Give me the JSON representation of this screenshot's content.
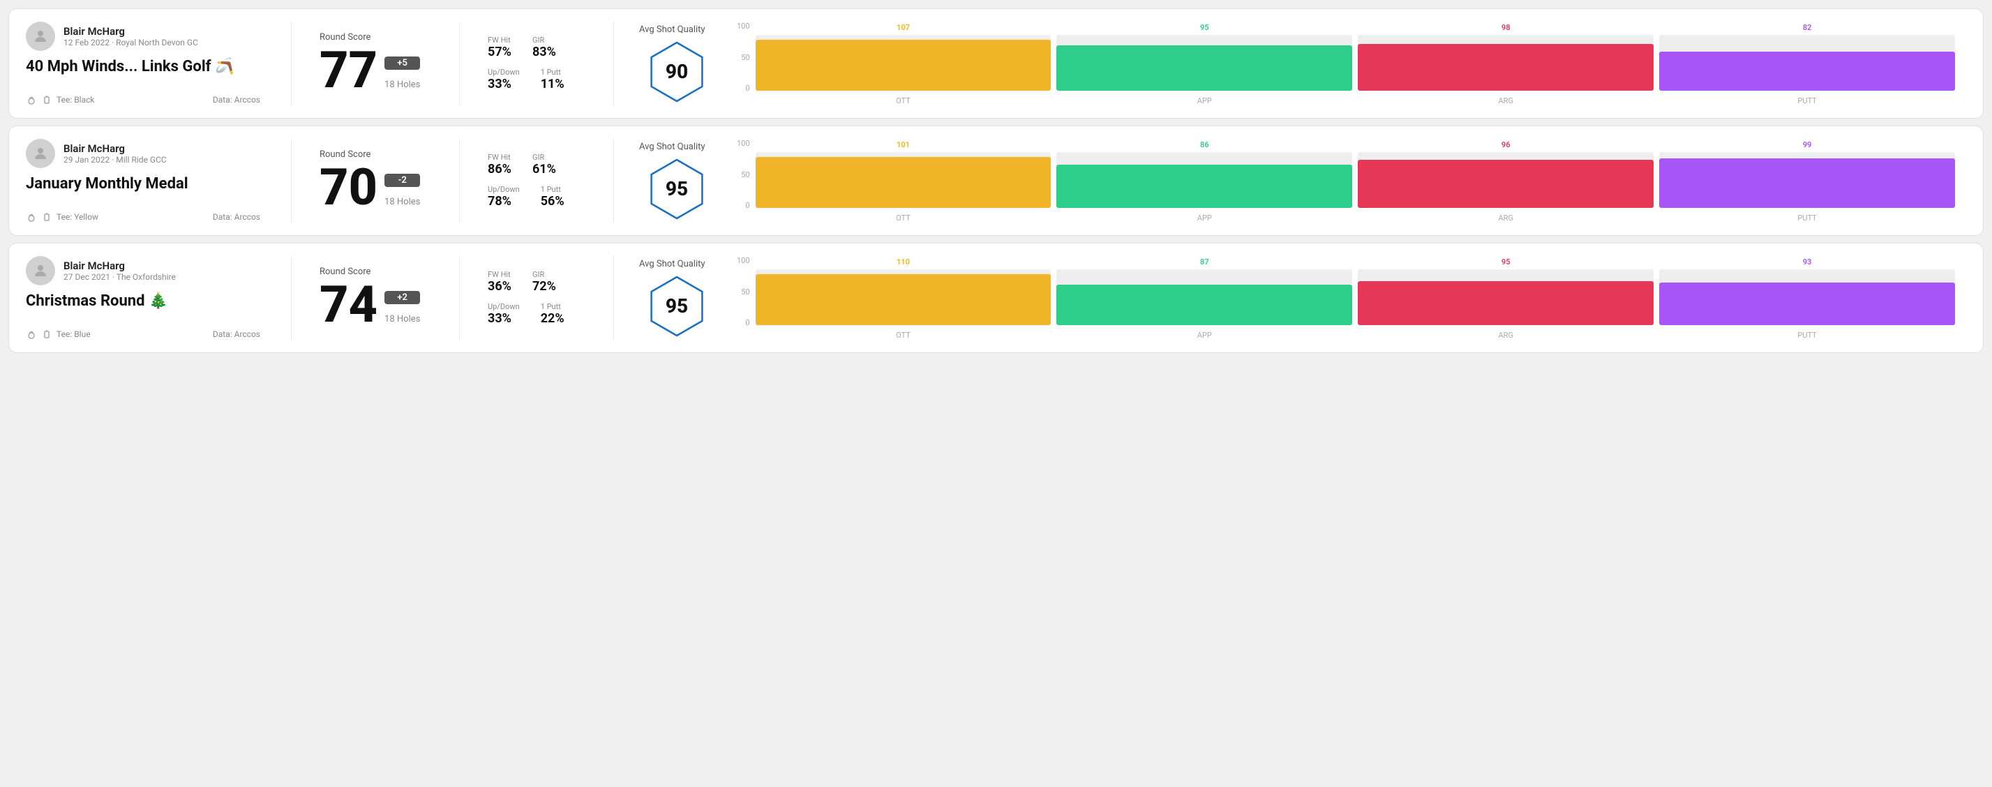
{
  "rounds": [
    {
      "id": "round1",
      "player": "Blair McHarg",
      "date": "12 Feb 2022 · Royal North Devon GC",
      "title": "40 Mph Winds... Links Golf 🪃",
      "tee": "Tee: Black",
      "data_source": "Data: Arccos",
      "score": "77",
      "score_diff": "+5",
      "holes": "18 Holes",
      "fw_hit": "57%",
      "gir": "83%",
      "up_down": "33%",
      "one_putt": "11%",
      "avg_quality_label": "Avg Shot Quality",
      "avg_quality": "90",
      "chart": {
        "ott": {
          "label": "OTT",
          "value": 107,
          "color_class": "ott-color",
          "bar_class": "ott-bar"
        },
        "app": {
          "label": "APP",
          "value": 95,
          "color_class": "app-color",
          "bar_class": "app-bar"
        },
        "arg": {
          "label": "ARG",
          "value": 98,
          "color_class": "arg-color",
          "bar_class": "arg-bar"
        },
        "putt": {
          "label": "PUTT",
          "value": 82,
          "color_class": "putt-color",
          "bar_class": "putt-bar"
        }
      },
      "chart_y": [
        "100",
        "50",
        "0"
      ]
    },
    {
      "id": "round2",
      "player": "Blair McHarg",
      "date": "29 Jan 2022 · Mill Ride GCC",
      "title": "January Monthly Medal",
      "tee": "Tee: Yellow",
      "data_source": "Data: Arccos",
      "score": "70",
      "score_diff": "-2",
      "holes": "18 Holes",
      "fw_hit": "86%",
      "gir": "61%",
      "up_down": "78%",
      "one_putt": "56%",
      "avg_quality_label": "Avg Shot Quality",
      "avg_quality": "95",
      "chart": {
        "ott": {
          "label": "OTT",
          "value": 101,
          "color_class": "ott-color",
          "bar_class": "ott-bar"
        },
        "app": {
          "label": "APP",
          "value": 86,
          "color_class": "app-color",
          "bar_class": "app-bar"
        },
        "arg": {
          "label": "ARG",
          "value": 96,
          "color_class": "arg-color",
          "bar_class": "arg-bar"
        },
        "putt": {
          "label": "PUTT",
          "value": 99,
          "color_class": "putt-color",
          "bar_class": "putt-bar"
        }
      },
      "chart_y": [
        "100",
        "50",
        "0"
      ]
    },
    {
      "id": "round3",
      "player": "Blair McHarg",
      "date": "27 Dec 2021 · The Oxfordshire",
      "title": "Christmas Round 🎄",
      "tee": "Tee: Blue",
      "data_source": "Data: Arccos",
      "score": "74",
      "score_diff": "+2",
      "holes": "18 Holes",
      "fw_hit": "36%",
      "gir": "72%",
      "up_down": "33%",
      "one_putt": "22%",
      "avg_quality_label": "Avg Shot Quality",
      "avg_quality": "95",
      "chart": {
        "ott": {
          "label": "OTT",
          "value": 110,
          "color_class": "ott-color",
          "bar_class": "ott-bar"
        },
        "app": {
          "label": "APP",
          "value": 87,
          "color_class": "app-color",
          "bar_class": "app-bar"
        },
        "arg": {
          "label": "ARG",
          "value": 95,
          "color_class": "arg-color",
          "bar_class": "arg-bar"
        },
        "putt": {
          "label": "PUTT",
          "value": 93,
          "color_class": "putt-color",
          "bar_class": "putt-bar"
        }
      },
      "chart_y": [
        "100",
        "50",
        "0"
      ]
    }
  ]
}
